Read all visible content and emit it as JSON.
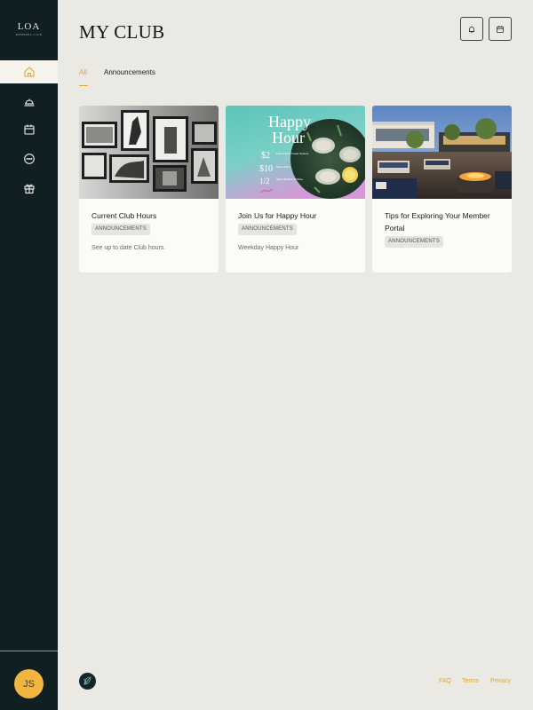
{
  "sidebar": {
    "logo_text": "LOA",
    "logo_subtext": "MEMBERS CLUB",
    "items": [
      {
        "name": "home-icon"
      },
      {
        "name": "cloche-icon"
      },
      {
        "name": "calendar-icon"
      },
      {
        "name": "chat-icon"
      },
      {
        "name": "gift-icon"
      }
    ],
    "avatar_initials": "JS"
  },
  "header": {
    "title": "MY CLUB",
    "buttons": [
      {
        "icon": "bell-icon"
      },
      {
        "icon": "calendar-icon"
      }
    ]
  },
  "tabs": [
    {
      "label": "All",
      "active": true
    },
    {
      "label": "Announcements",
      "active": false
    }
  ],
  "cards": [
    {
      "title": "Current Club Hours",
      "badge": "ANNOUNCEMENTS",
      "description": "See up to date Club hours.",
      "image": "gallery-wall-photo"
    },
    {
      "title": "Join Us for Happy Hour",
      "badge": "ANNOUNCEMENTS",
      "description": "Weekday Happy Hour",
      "image": "happy-hour-oysters-photo",
      "image_text": {
        "headline1": "Happy",
        "headline2": "Hour",
        "price1": "$2",
        "item1": "East & West Coast Oysters",
        "price2": "$10",
        "item2": "Select Wine",
        "price3": "1/2",
        "item3": "Select Bottles Of Wine"
      }
    },
    {
      "title": "Tips for Exploring Your Member Portal",
      "badge": "ANNOUNCEMENTS",
      "description": "",
      "image": "rooftop-terrace-photo"
    }
  ],
  "footer": {
    "links": [
      "FAQ",
      "Terms",
      "Privacy"
    ]
  },
  "colors": {
    "sidebar_bg": "#0f1f22",
    "page_bg": "#ebe9e4",
    "accent": "#e0a43a",
    "avatar": "#f2b53f",
    "card_bg": "#fcfbf8"
  }
}
